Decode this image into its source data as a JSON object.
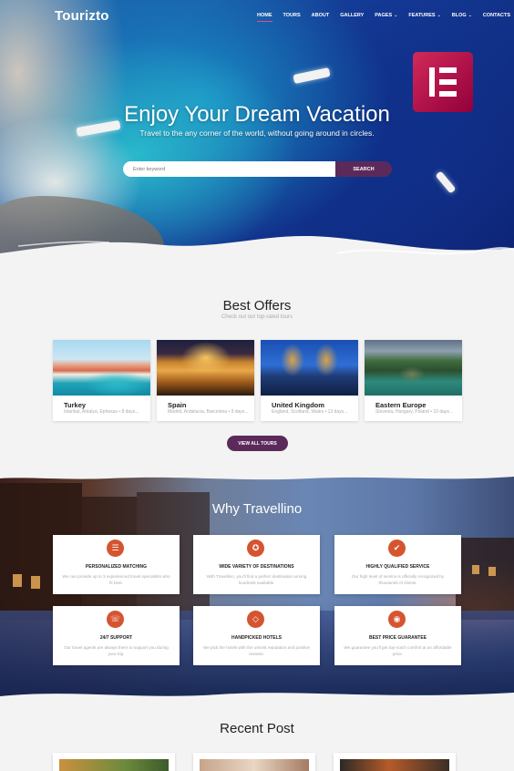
{
  "header": {
    "logo": "Tourizto",
    "nav": [
      {
        "label": "HOME",
        "dropdown": false,
        "active": true
      },
      {
        "label": "TOURS",
        "dropdown": false,
        "active": false
      },
      {
        "label": "ABOUT",
        "dropdown": false,
        "active": false
      },
      {
        "label": "GALLERY",
        "dropdown": false,
        "active": false
      },
      {
        "label": "PAGES",
        "dropdown": true,
        "active": false
      },
      {
        "label": "FEATURES",
        "dropdown": true,
        "active": false
      },
      {
        "label": "BLOG",
        "dropdown": true,
        "active": false
      },
      {
        "label": "CONTACTS",
        "dropdown": false,
        "active": false
      }
    ]
  },
  "hero": {
    "title": "Enjoy Your Dream Vacation",
    "subtitle": "Travel to the any corner of the world, without going around in circles.",
    "search_placeholder": "Enter keyword",
    "search_button": "SEARCH"
  },
  "offers": {
    "title": "Best Offers",
    "subtitle": "Check out our top-rated tours",
    "items": [
      {
        "name": "Turkey",
        "desc": "Istanbul, Antalya, Ephesus • 8 days..."
      },
      {
        "name": "Spain",
        "desc": "Madrid, Andalucia, Barcelona • 9 days..."
      },
      {
        "name": "United Kingdom",
        "desc": "England, Scotland, Wales • 13 days..."
      },
      {
        "name": "Eastern Europe",
        "desc": "Slovenia, Hungary, Poland • 10 days..."
      }
    ],
    "view_all": "VIEW ALL TOURS"
  },
  "why": {
    "title": "Why Travellino",
    "features": [
      {
        "title": "PERSONALIZED MATCHING",
        "text": "We can provide up to 3 experienced travel specialists who fit best.",
        "icon": "sliders-icon"
      },
      {
        "title": "WIDE VARIETY OF DESTINATIONS",
        "text": "With Travellino, you'll find a perfect destination among hundreds available.",
        "icon": "badge-icon"
      },
      {
        "title": "HIGHLY QUALIFIED SERVICE",
        "text": "Our high level of service is officially recognized by thousands of clients.",
        "icon": "thumbs-up-icon"
      },
      {
        "title": "24/7 SUPPORT",
        "text": "Our travel agents are always there to support you during your trip.",
        "icon": "headset-icon"
      },
      {
        "title": "HANDPICKED HOTELS",
        "text": "We pick the hotels with the utmost reputation and positive reviews.",
        "icon": "diamond-icon"
      },
      {
        "title": "BEST PRICE GUARANTEE",
        "text": "We guarantee you'll get top-notch comfort at an affordable price.",
        "icon": "coins-icon"
      }
    ],
    "accent": "#d4552f"
  },
  "recent": {
    "title": "Recent Post"
  },
  "colors": {
    "brand_purple": "#5b2a5a",
    "elementor": "#d2295a"
  }
}
